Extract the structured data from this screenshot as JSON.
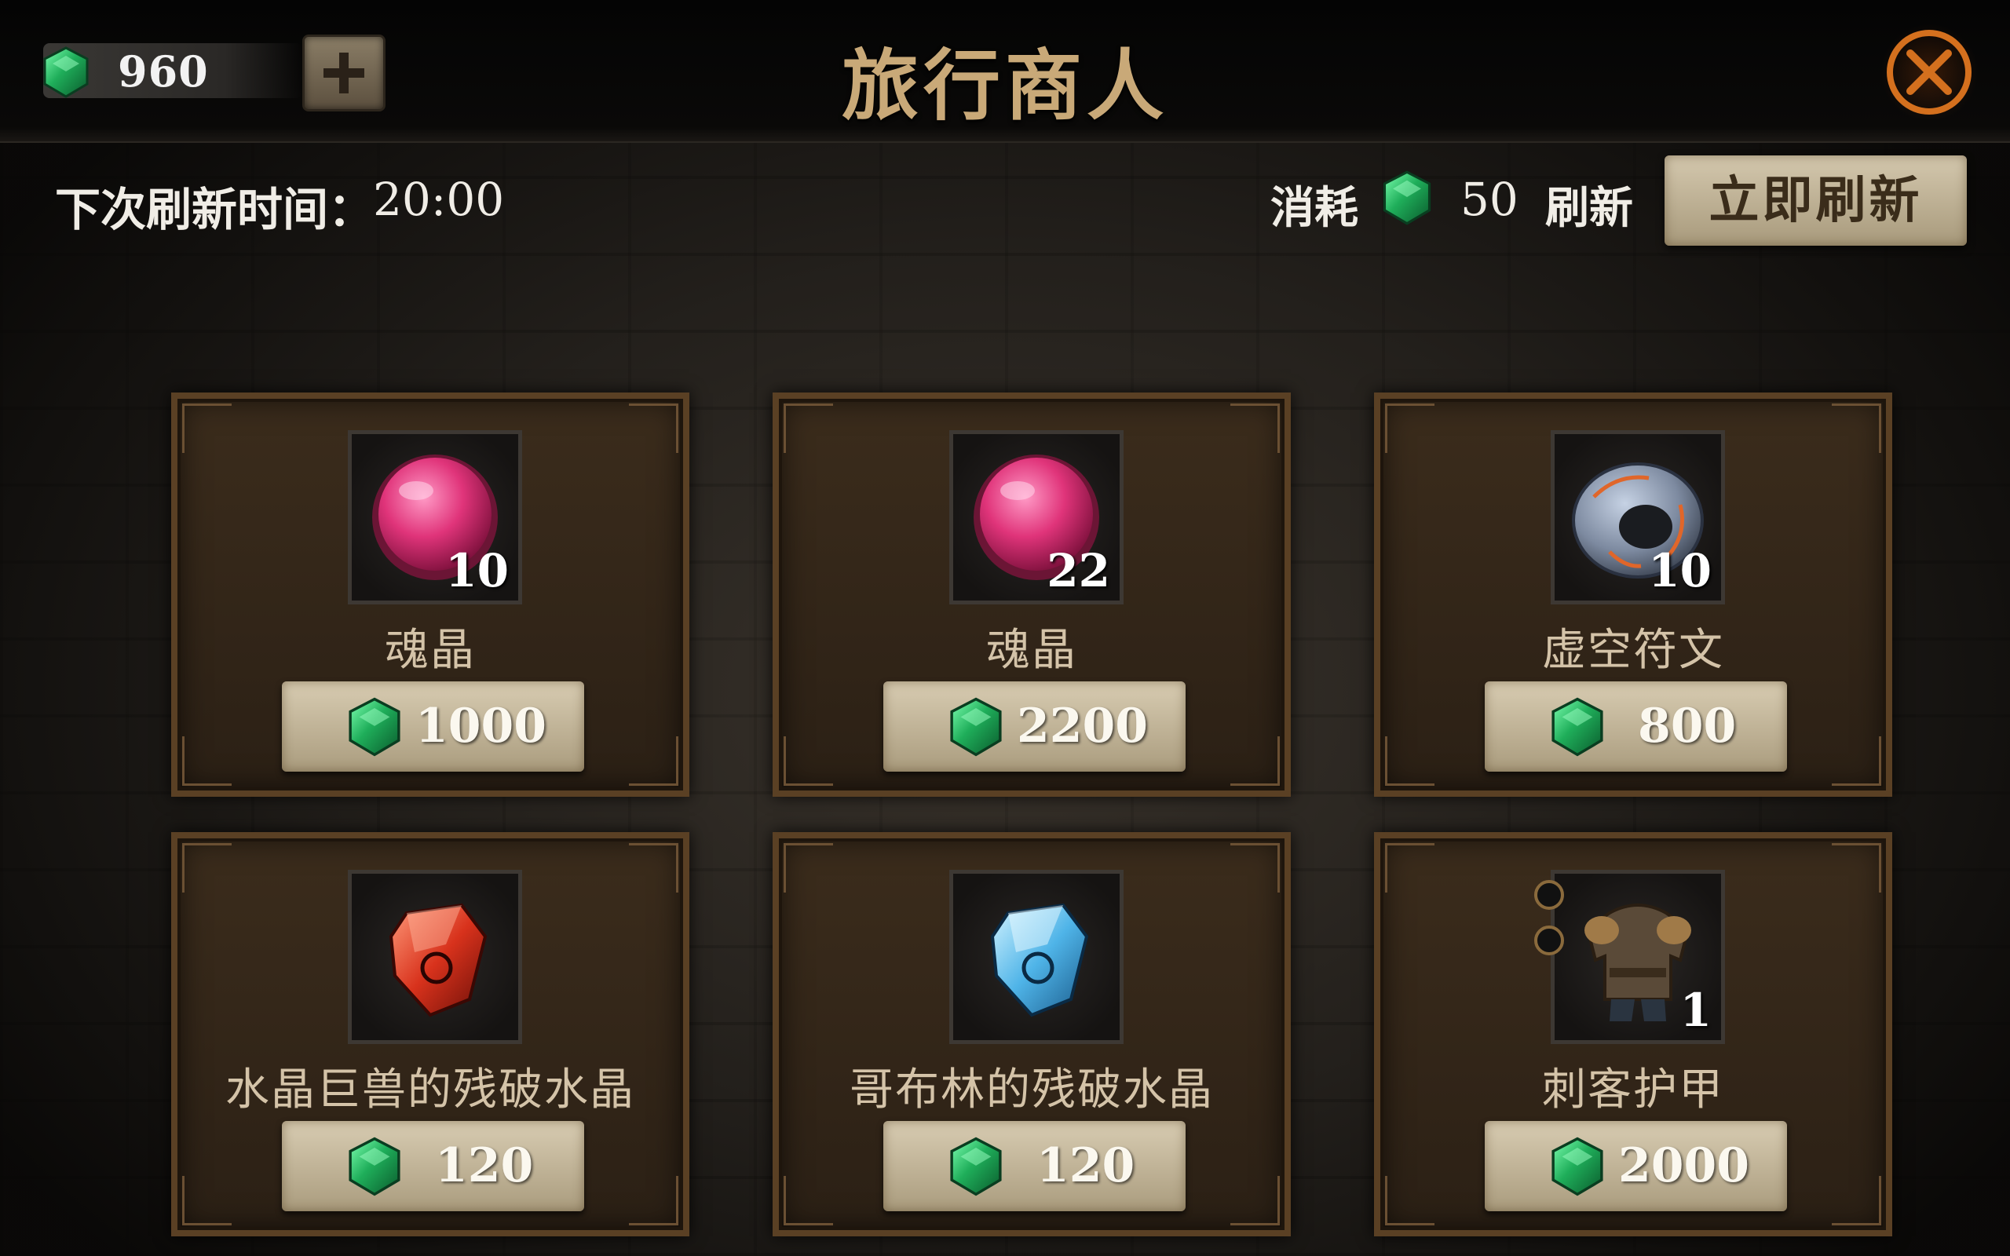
{
  "header": {
    "title": "旅行商人",
    "gem_balance": "960"
  },
  "refresh": {
    "label": "下次刷新时间：",
    "time": "20:00",
    "cost_label": "消耗",
    "cost_value": "50",
    "cost_suffix": "刷新",
    "button_label": "立即刷新"
  },
  "items": [
    {
      "name": "魂晶",
      "quantity": "10",
      "price": "1000",
      "icon": "soul-crystal-orb-icon"
    },
    {
      "name": "魂晶",
      "quantity": "22",
      "price": "2200",
      "icon": "soul-crystal-orb-icon"
    },
    {
      "name": "虚空符文",
      "quantity": "10",
      "price": "800",
      "icon": "void-rune-ring-icon"
    },
    {
      "name": "水晶巨兽的残破水晶",
      "quantity": "",
      "price": "120",
      "icon": "red-crystal-shard-icon"
    },
    {
      "name": "哥布林的残破水晶",
      "quantity": "",
      "price": "120",
      "icon": "blue-crystal-shard-icon"
    },
    {
      "name": "刺客护甲",
      "quantity": "1",
      "price": "2000",
      "icon": "assassin-armor-icon"
    }
  ],
  "colors": {
    "title": "#c9a978",
    "gem": "#1fae5a",
    "orb": "#e0347a",
    "card_border": "#5a4024",
    "button": "#c9bc9f"
  }
}
